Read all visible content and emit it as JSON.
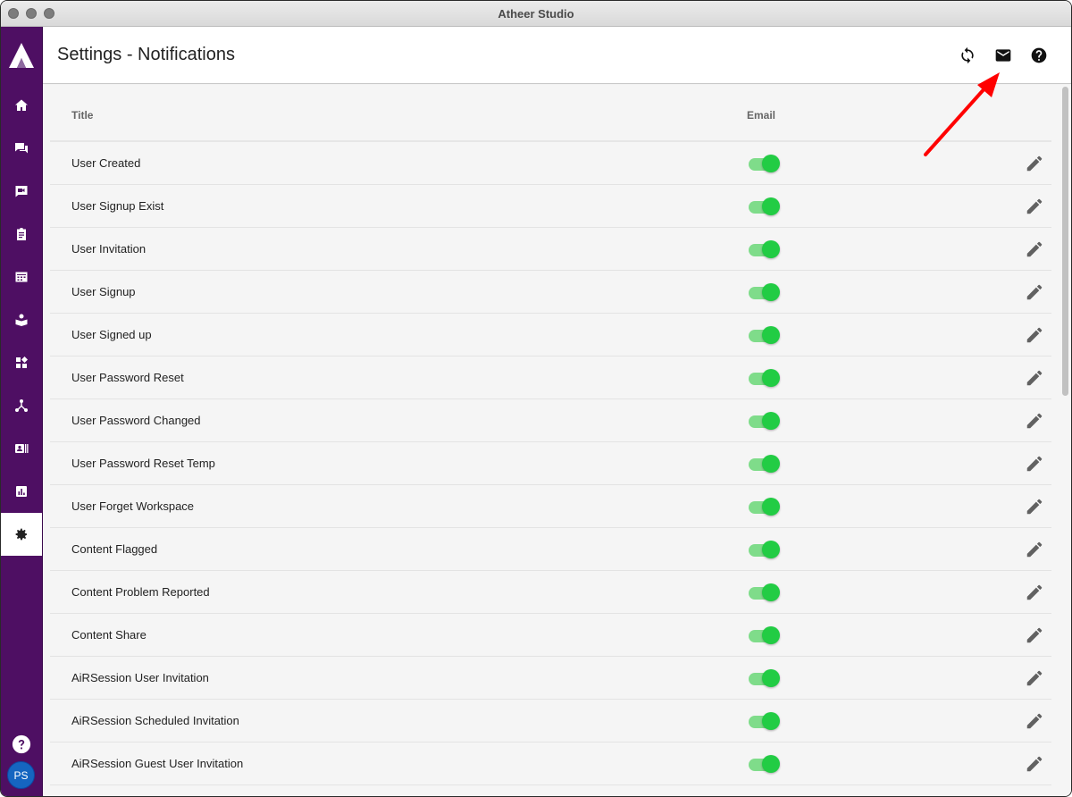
{
  "window": {
    "title": "Atheer Studio"
  },
  "header": {
    "title": "Settings - Notifications"
  },
  "header_icons": [
    "refresh-icon",
    "email-icon",
    "help-icon"
  ],
  "sidebar": {
    "items": [
      {
        "icon": "home-icon"
      },
      {
        "icon": "chat-icon"
      },
      {
        "icon": "video-chat-icon"
      },
      {
        "icon": "clipboard-icon"
      },
      {
        "icon": "calendar-icon"
      },
      {
        "icon": "book-icon"
      },
      {
        "icon": "dashboard-icon"
      },
      {
        "icon": "workflow-icon"
      },
      {
        "icon": "contact-card-icon"
      },
      {
        "icon": "chart-icon"
      },
      {
        "icon": "settings-icon",
        "active": true
      }
    ],
    "avatar_initials": "PS"
  },
  "table": {
    "columns": {
      "title": "Title",
      "email": "Email"
    },
    "rows": [
      {
        "title": "User Created",
        "email": true
      },
      {
        "title": "User Signup Exist",
        "email": true
      },
      {
        "title": "User Invitation",
        "email": true
      },
      {
        "title": "User Signup",
        "email": true
      },
      {
        "title": "User Signed up",
        "email": true
      },
      {
        "title": "User Password Reset",
        "email": true
      },
      {
        "title": "User Password Changed",
        "email": true
      },
      {
        "title": "User Password Reset Temp",
        "email": true
      },
      {
        "title": "User Forget Workspace",
        "email": true
      },
      {
        "title": "Content Flagged",
        "email": true
      },
      {
        "title": "Content Problem Reported",
        "email": true
      },
      {
        "title": "Content Share",
        "email": true
      },
      {
        "title": "AiRSession User Invitation",
        "email": true
      },
      {
        "title": "AiRSession Scheduled Invitation",
        "email": true
      },
      {
        "title": "AiRSession Guest User Invitation",
        "email": true
      }
    ]
  },
  "colors": {
    "sidebar": "#4e0f63",
    "toggle_on": "#22cc44",
    "annotation_arrow": "#ff0000"
  }
}
